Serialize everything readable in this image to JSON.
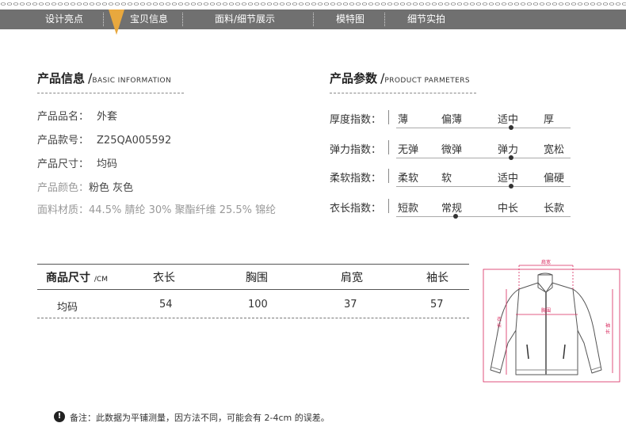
{
  "nav": {
    "items": [
      "设计亮点",
      "宝贝信息",
      "面料/细节展示",
      "模特图",
      "细节实拍"
    ]
  },
  "product_info": {
    "title_cn": "产品信息",
    "slash": "/",
    "title_en": "BASIC INFORMATION",
    "rows": [
      {
        "label": "产品品名：",
        "value": "外套"
      },
      {
        "label": "产品款号：",
        "value": "Z25QA005592"
      },
      {
        "label": "产品尺寸：",
        "value": "均码"
      },
      {
        "label": "产品颜色：",
        "value": "粉色 灰色"
      },
      {
        "label": "面料材质：",
        "value": "44.5% 腈纶 30% 聚酯纤维 25.5% 锦纶"
      }
    ]
  },
  "product_params": {
    "title_cn": "产品参数",
    "slash": "/",
    "title_en": "PRODUCT PARMETERS",
    "rows": [
      {
        "label": "厚度指数：",
        "options": [
          "薄",
          "偏薄",
          "适中",
          "厚"
        ],
        "selected": 2
      },
      {
        "label": "弹力指数：",
        "options": [
          "无弹",
          "微弹",
          "弹力",
          "宽松"
        ],
        "selected": 2
      },
      {
        "label": "柔软指数：",
        "options": [
          "柔软",
          "软",
          "适中",
          "偏硬"
        ],
        "selected": 2
      },
      {
        "label": "衣长指数：",
        "options": [
          "短款",
          "常规",
          "中长",
          "长款"
        ],
        "selected": 1
      }
    ]
  },
  "size_table": {
    "header_label": "商品尺寸",
    "header_unit": "/CM",
    "columns": [
      "衣长",
      "胸围",
      "肩宽",
      "袖长"
    ],
    "rows": [
      {
        "size": "均码",
        "values": [
          "54",
          "100",
          "37",
          "57"
        ]
      }
    ]
  },
  "diagram": {
    "labels": {
      "shoulder": "肩宽",
      "chest": "胸围",
      "length_1": "衣",
      "length_2": "长",
      "sleeve_1": "袖",
      "sleeve_2": "长"
    },
    "accent_color": "#d8275c"
  },
  "note": {
    "icon": "!",
    "text": "备注：此数据为平铺测量，因方法不同，可能会有 2-4cm 的误差。"
  }
}
